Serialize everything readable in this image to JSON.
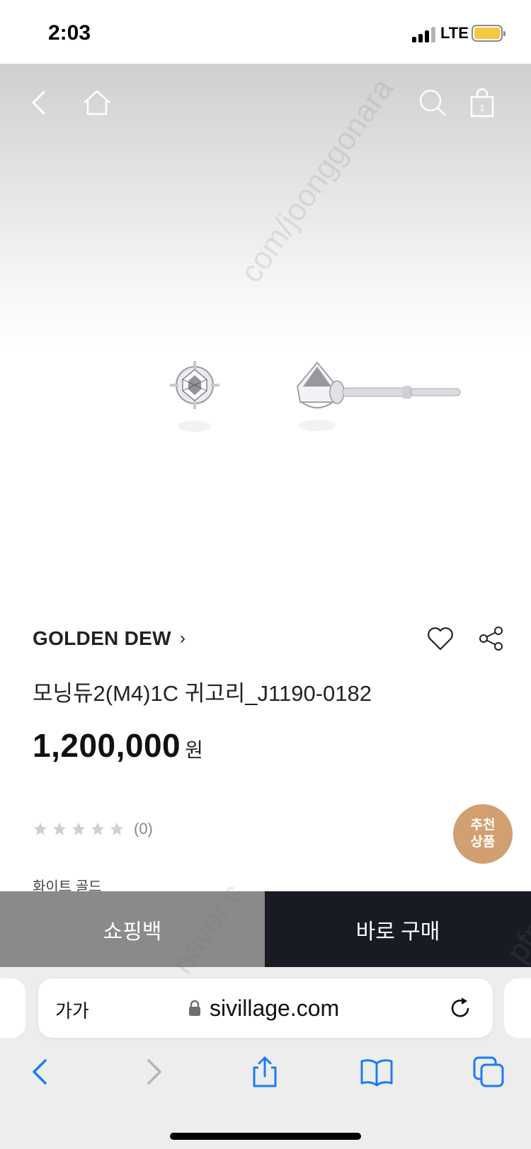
{
  "status_bar": {
    "time": "2:03",
    "network": "LTE"
  },
  "hero": {
    "cart_count": "1"
  },
  "product": {
    "brand": "GOLDEN DEW",
    "brand_chevron": "›",
    "title": "모닝듀2(M4)1C 귀고리_J1190-0182",
    "price": "1,200,000",
    "price_unit": "원",
    "rating": 0,
    "review_count": "(0)",
    "option": "화이트 골드",
    "recommend_badge": "추천\n상품"
  },
  "bottom_bar": {
    "bag_label": "쇼핑백",
    "buy_label": "바로 구매"
  },
  "safari": {
    "aa_label": "가가",
    "url": "sivillage.com"
  },
  "watermarks": [
    "com/joonggonara",
    "naver.c",
    "pfm"
  ],
  "colors": {
    "buy_button": "#181b24",
    "bag_button": "#8a8a8a",
    "recommend_badge": "#d29f70",
    "safari_blue": "#1a7cf5"
  }
}
